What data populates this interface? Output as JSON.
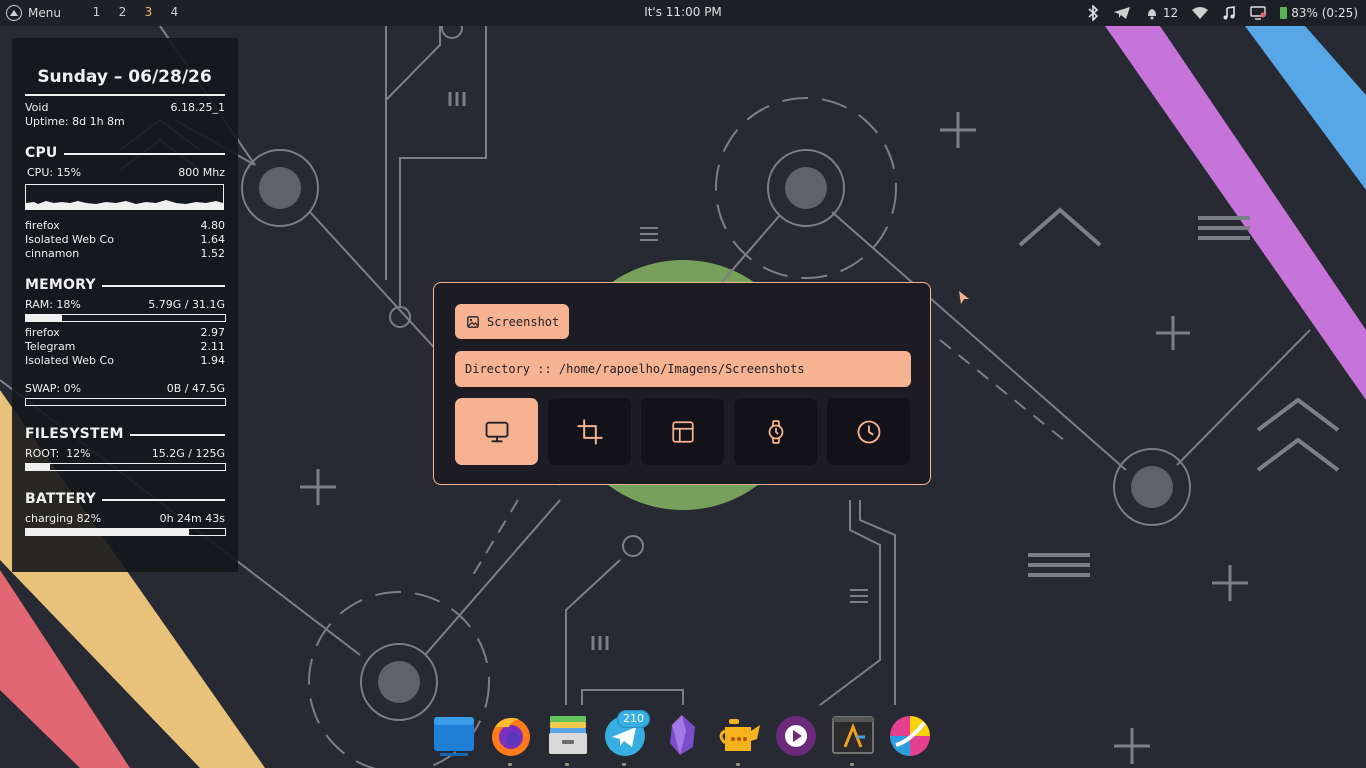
{
  "top_panel": {
    "menu_label": "Menu",
    "workspaces": [
      "1",
      "2",
      "3",
      "4"
    ],
    "active_workspace": "3",
    "clock": "It's 11:00 PM",
    "notifications_count": "12",
    "battery": "83% (0:25)",
    "icons": [
      "bluetooth-icon",
      "telegram-icon",
      "notification-bell-icon",
      "wifi-icon",
      "music-icon",
      "screen-icon",
      "battery-icon"
    ]
  },
  "conky": {
    "date": "Sunday – 06/28/26",
    "os": "Void",
    "kernel": "6.18.25_1",
    "uptime": "Uptime: 8d 1h 8m",
    "cpu": {
      "title": "CPU",
      "usage": "CPU: 15%",
      "freq": "800 Mhz",
      "processes": [
        {
          "name": "firefox",
          "value": "4.80"
        },
        {
          "name": "Isolated Web Co",
          "value": "1.64"
        },
        {
          "name": "cinnamon",
          "value": "1.52"
        }
      ]
    },
    "memory": {
      "title": "MEMORY",
      "ram": "RAM: 18%",
      "ram_value": "5.79G / 31.1G",
      "ram_fraction": 0.18,
      "processes": [
        {
          "name": "firefox",
          "value": "2.97"
        },
        {
          "name": "Telegram",
          "value": "2.11"
        },
        {
          "name": "Isolated Web Co",
          "value": "1.94"
        }
      ],
      "swap": "SWAP: 0%",
      "swap_value": "0B / 47.5G",
      "swap_fraction": 0.0
    },
    "filesystem": {
      "title": "FILESYSTEM",
      "root": "ROOT:  12%",
      "root_value": "15.2G / 125G",
      "root_fraction": 0.12
    },
    "battery": {
      "title": "BATTERY",
      "status": "charging 82%",
      "time": "0h 24m 43s",
      "fraction": 0.82
    }
  },
  "screenshot_dialog": {
    "title": "Screenshot",
    "directory": "Directory :: /home/rapoelho/Imagens/Screenshots",
    "modes": [
      "monitor-icon",
      "crop-icon",
      "window-layout-icon",
      "watch-icon",
      "clock-icon"
    ],
    "active_mode": "monitor-icon"
  },
  "dock": {
    "apps": [
      "files-app",
      "firefox",
      "archive-manager",
      "telegram",
      "obsidian",
      "teapot-app",
      "media-player",
      "terminal-app",
      "krita"
    ],
    "telegram_badge": "210"
  },
  "colors": {
    "background": "#272a33",
    "accent": "#f6b391",
    "dialog_bg": "#1d1b24",
    "wallpaper_lines": "#7b7f89",
    "stripe_purple": "#c674d9",
    "stripe_blue": "#57a6e6",
    "stripe_yellow": "#e8c27a",
    "stripe_red": "#e16872"
  }
}
